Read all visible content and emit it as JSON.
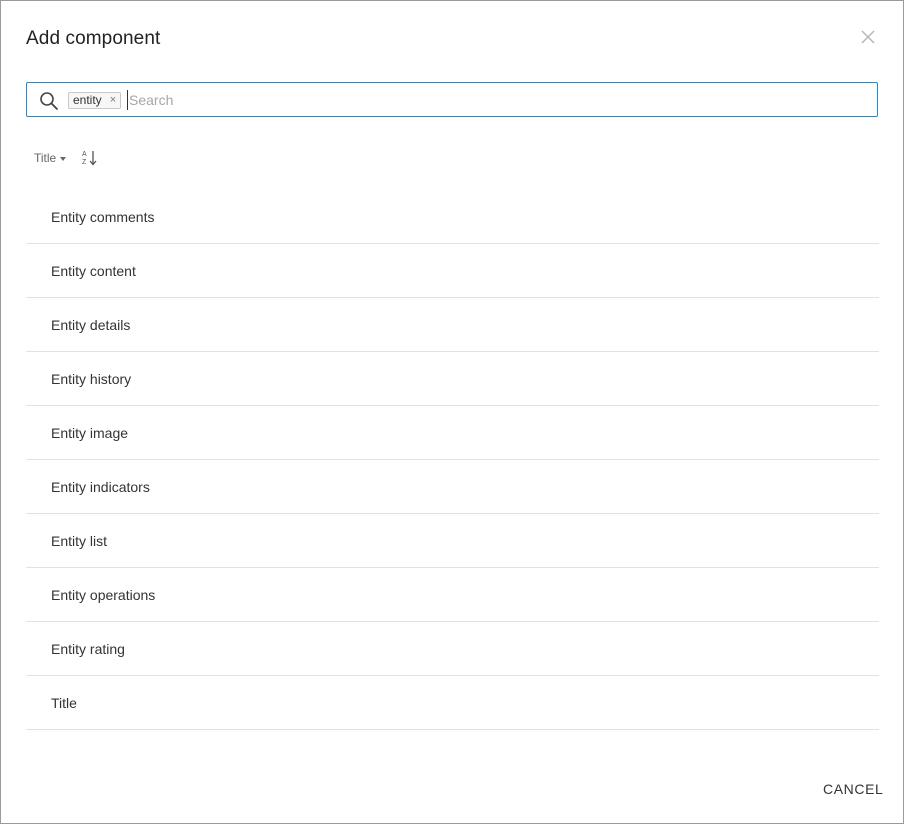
{
  "dialog": {
    "title": "Add component",
    "close_icon": "close-icon"
  },
  "search": {
    "icon": "search-icon",
    "chips": [
      {
        "label": "entity",
        "remove_glyph": "×"
      }
    ],
    "value": "",
    "placeholder": "Search",
    "border_color": "#1c8ad6"
  },
  "sort": {
    "field_label": "Title",
    "field_icon": "caret-down-icon",
    "order_icon": "sort-alpha-ascending-icon"
  },
  "components": [
    {
      "label": "Entity comments"
    },
    {
      "label": "Entity content"
    },
    {
      "label": "Entity details"
    },
    {
      "label": "Entity history"
    },
    {
      "label": "Entity image"
    },
    {
      "label": "Entity indicators"
    },
    {
      "label": "Entity list"
    },
    {
      "label": "Entity operations"
    },
    {
      "label": "Entity rating"
    },
    {
      "label": "Title"
    }
  ],
  "footer": {
    "cancel_label": "CANCEL"
  }
}
